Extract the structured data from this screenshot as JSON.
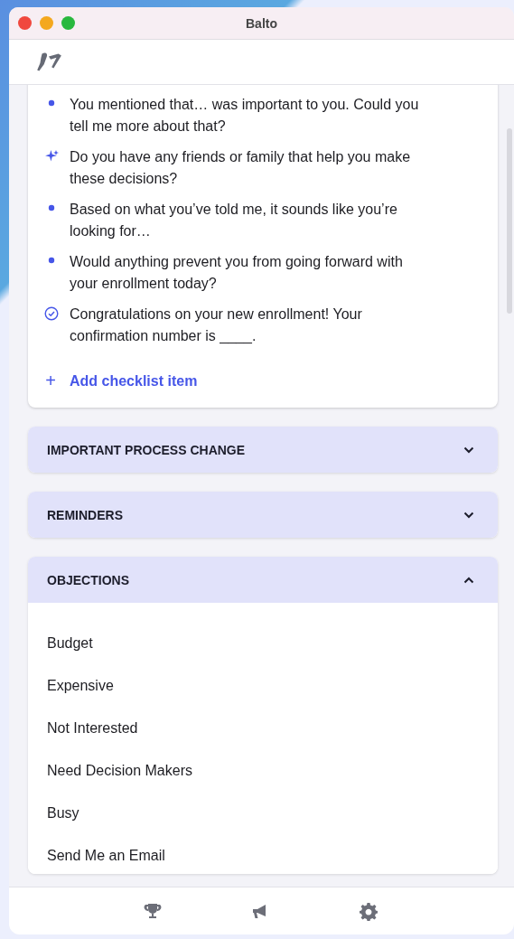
{
  "window": {
    "title": "Balto"
  },
  "checklist": {
    "items": [
      {
        "kind": "bullet",
        "text": "You mentioned that… was important to you. Could you tell me more about that?"
      },
      {
        "kind": "sparkle",
        "text": "Do you have any friends or family that help you make these decisions?"
      },
      {
        "kind": "bullet",
        "text": "Based on what you’ve told me, it sounds like you’re looking for…"
      },
      {
        "kind": "bullet",
        "text": "Would anything prevent you from going forward with your enrollment today?"
      },
      {
        "kind": "check",
        "text": "Congratulations on your new enrollment! Your confirmation number is ____."
      }
    ],
    "add_button": {
      "icon": "+",
      "label": "Add checklist item"
    }
  },
  "sections": [
    {
      "title": "IMPORTANT PROCESS CHANGE",
      "expanded": false
    },
    {
      "title": "REMINDERS",
      "expanded": false
    },
    {
      "title": "OBJECTIONS",
      "expanded": true,
      "items": [
        "Budget",
        "Expensive",
        "Not Interested",
        "Need Decision Makers",
        "Busy",
        "Send Me an Email"
      ]
    }
  ],
  "nav": [
    {
      "kind": "trophy"
    },
    {
      "kind": "megaphone"
    },
    {
      "kind": "settings"
    }
  ]
}
